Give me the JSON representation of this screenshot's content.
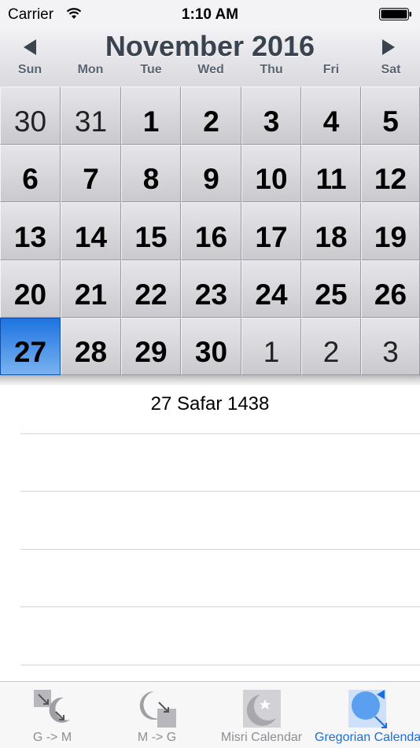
{
  "status_bar": {
    "carrier": "Carrier",
    "time": "1:10 AM"
  },
  "calendar": {
    "month_title": "November 2016",
    "weekdays": [
      "Sun",
      "Mon",
      "Tue",
      "Wed",
      "Thu",
      "Fri",
      "Sat"
    ],
    "weeks": [
      [
        {
          "day": "30",
          "current": false
        },
        {
          "day": "31",
          "current": false
        },
        {
          "day": "1",
          "current": true
        },
        {
          "day": "2",
          "current": true
        },
        {
          "day": "3",
          "current": true
        },
        {
          "day": "4",
          "current": true
        },
        {
          "day": "5",
          "current": true
        }
      ],
      [
        {
          "day": "6",
          "current": true
        },
        {
          "day": "7",
          "current": true
        },
        {
          "day": "8",
          "current": true
        },
        {
          "day": "9",
          "current": true
        },
        {
          "day": "10",
          "current": true
        },
        {
          "day": "11",
          "current": true
        },
        {
          "day": "12",
          "current": true
        }
      ],
      [
        {
          "day": "13",
          "current": true
        },
        {
          "day": "14",
          "current": true
        },
        {
          "day": "15",
          "current": true
        },
        {
          "day": "16",
          "current": true
        },
        {
          "day": "17",
          "current": true
        },
        {
          "day": "18",
          "current": true
        },
        {
          "day": "19",
          "current": true
        }
      ],
      [
        {
          "day": "20",
          "current": true
        },
        {
          "day": "21",
          "current": true
        },
        {
          "day": "22",
          "current": true
        },
        {
          "day": "23",
          "current": true
        },
        {
          "day": "24",
          "current": true
        },
        {
          "day": "25",
          "current": true
        },
        {
          "day": "26",
          "current": true
        }
      ],
      [
        {
          "day": "27",
          "current": true,
          "selected": true
        },
        {
          "day": "28",
          "current": true
        },
        {
          "day": "29",
          "current": true
        },
        {
          "day": "30",
          "current": true
        },
        {
          "day": "1",
          "current": false
        },
        {
          "day": "2",
          "current": false
        },
        {
          "day": "3",
          "current": false
        }
      ]
    ],
    "accent_color": "#1d73e0"
  },
  "detail": {
    "hijri_date": "27 Safar 1438"
  },
  "tab_bar": {
    "tabs": [
      {
        "label": "G -> M",
        "icon": "gregorian-to-misri-icon",
        "active": false
      },
      {
        "label": "M -> G",
        "icon": "misri-to-gregorian-icon",
        "active": false
      },
      {
        "label": "Misri Calendar",
        "icon": "crescent-star-icon",
        "active": false
      },
      {
        "label": "Gregorian Calendar",
        "icon": "globe-icon",
        "active": true
      }
    ],
    "active_color": "#1a6fe0",
    "inactive_color": "#8e8e93"
  }
}
